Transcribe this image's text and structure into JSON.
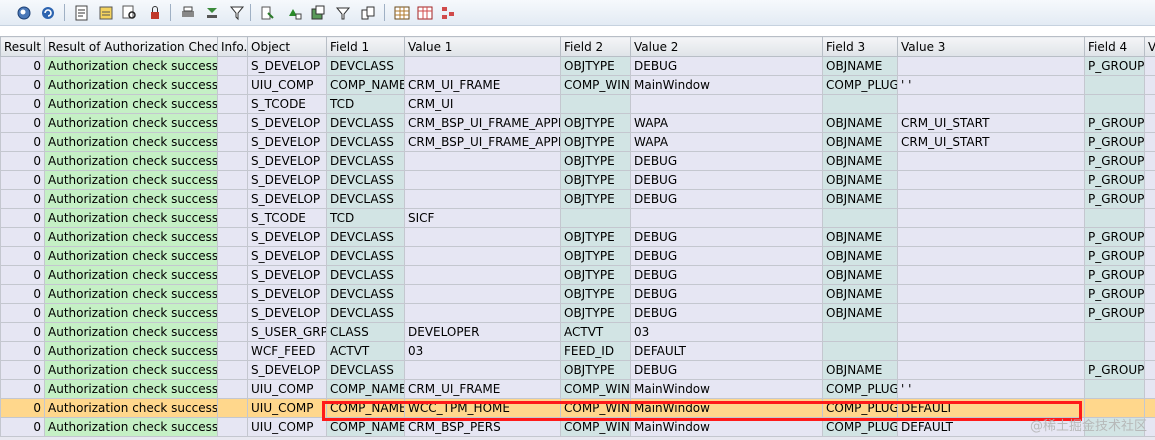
{
  "toolbar": {
    "buttons": [
      {
        "icon": "refresh-icon"
      },
      {
        "icon": "reload-icon"
      },
      {
        "icon": "details-icon"
      },
      {
        "icon": "select-all-icon"
      },
      {
        "icon": "find-icon"
      },
      {
        "icon": "lock-icon"
      },
      {
        "icon": "print-icon"
      },
      {
        "icon": "sort-icon"
      },
      {
        "icon": "filter-icon"
      },
      {
        "icon": "sum-icon"
      },
      {
        "icon": "subtotal-icon"
      },
      {
        "icon": "export-icon"
      },
      {
        "icon": "layout-icon"
      },
      {
        "icon": "view-icon"
      },
      {
        "icon": "grid-icon"
      },
      {
        "icon": "columns-icon"
      },
      {
        "icon": "tree-icon"
      }
    ]
  },
  "table": {
    "headers": [
      "Result",
      "Result of Authorization Check",
      "Info.",
      "Object",
      "Field 1",
      "Value 1",
      "Field 2",
      "Value 2",
      "Field 3",
      "Value 3",
      "Field 4",
      "V"
    ],
    "rows": [
      [
        "0",
        "Authorization check successful",
        "",
        "S_DEVELOP",
        "DEVCLASS",
        "",
        "OBJTYPE",
        "DEBUG",
        "OBJNAME",
        "",
        "P_GROUP",
        ""
      ],
      [
        "0",
        "Authorization check successful",
        "",
        "UIU_COMP",
        "COMP_NAME",
        "CRM_UI_FRAME",
        "COMP_WIN",
        "MainWindow",
        "COMP_PLUG",
        "' '",
        "",
        ""
      ],
      [
        "0",
        "Authorization check successful",
        "",
        "S_TCODE",
        "TCD",
        "CRM_UI",
        "",
        "",
        "",
        "",
        "",
        ""
      ],
      [
        "0",
        "Authorization check successful",
        "",
        "S_DEVELOP",
        "DEVCLASS",
        "CRM_BSP_UI_FRAME_APPL",
        "OBJTYPE",
        "WAPA",
        "OBJNAME",
        "CRM_UI_START",
        "P_GROUP",
        ""
      ],
      [
        "0",
        "Authorization check successful",
        "",
        "S_DEVELOP",
        "DEVCLASS",
        "CRM_BSP_UI_FRAME_APPL",
        "OBJTYPE",
        "WAPA",
        "OBJNAME",
        "CRM_UI_START",
        "P_GROUP",
        ""
      ],
      [
        "0",
        "Authorization check successful",
        "",
        "S_DEVELOP",
        "DEVCLASS",
        "",
        "OBJTYPE",
        "DEBUG",
        "OBJNAME",
        "",
        "P_GROUP",
        ""
      ],
      [
        "0",
        "Authorization check successful",
        "",
        "S_DEVELOP",
        "DEVCLASS",
        "",
        "OBJTYPE",
        "DEBUG",
        "OBJNAME",
        "",
        "P_GROUP",
        ""
      ],
      [
        "0",
        "Authorization check successful",
        "",
        "S_DEVELOP",
        "DEVCLASS",
        "",
        "OBJTYPE",
        "DEBUG",
        "OBJNAME",
        "",
        "P_GROUP",
        ""
      ],
      [
        "0",
        "Authorization check successful",
        "",
        "S_TCODE",
        "TCD",
        "SICF",
        "",
        "",
        "",
        "",
        "",
        ""
      ],
      [
        "0",
        "Authorization check successful",
        "",
        "S_DEVELOP",
        "DEVCLASS",
        "",
        "OBJTYPE",
        "DEBUG",
        "OBJNAME",
        "",
        "P_GROUP",
        ""
      ],
      [
        "0",
        "Authorization check successful",
        "",
        "S_DEVELOP",
        "DEVCLASS",
        "",
        "OBJTYPE",
        "DEBUG",
        "OBJNAME",
        "",
        "P_GROUP",
        ""
      ],
      [
        "0",
        "Authorization check successful",
        "",
        "S_DEVELOP",
        "DEVCLASS",
        "",
        "OBJTYPE",
        "DEBUG",
        "OBJNAME",
        "",
        "P_GROUP",
        ""
      ],
      [
        "0",
        "Authorization check successful",
        "",
        "S_DEVELOP",
        "DEVCLASS",
        "",
        "OBJTYPE",
        "DEBUG",
        "OBJNAME",
        "",
        "P_GROUP",
        ""
      ],
      [
        "0",
        "Authorization check successful",
        "",
        "S_DEVELOP",
        "DEVCLASS",
        "",
        "OBJTYPE",
        "DEBUG",
        "OBJNAME",
        "",
        "P_GROUP",
        ""
      ],
      [
        "0",
        "Authorization check successful",
        "",
        "S_USER_GRP",
        "CLASS",
        "DEVELOPER",
        "ACTVT",
        "03",
        "",
        "",
        "",
        ""
      ],
      [
        "0",
        "Authorization check successful",
        "",
        "WCF_FEED",
        "ACTVT",
        "03",
        "FEED_ID",
        "DEFAULT",
        "",
        "",
        "",
        ""
      ],
      [
        "0",
        "Authorization check successful",
        "",
        "S_DEVELOP",
        "DEVCLASS",
        "",
        "OBJTYPE",
        "DEBUG",
        "OBJNAME",
        "",
        "P_GROUP",
        ""
      ],
      [
        "0",
        "Authorization check successful",
        "",
        "UIU_COMP",
        "COMP_NAME",
        "CRM_UI_FRAME",
        "COMP_WIN",
        "MainWindow",
        "COMP_PLUG",
        "' '",
        "",
        ""
      ],
      [
        "0",
        "Authorization check successful",
        "",
        "UIU_COMP",
        "COMP_NAME",
        "WCC_TPM_HOME",
        "COMP_WIN",
        "MainWindow",
        "COMP_PLUG",
        "DEFAULT",
        "",
        ""
      ],
      [
        "0",
        "Authorization check successful",
        "",
        "UIU_COMP",
        "COMP_NAME",
        "CRM_BSP_PERS",
        "COMP_WIN",
        "MainWindow",
        "COMP_PLUG",
        "DEFAULT",
        "",
        ""
      ]
    ],
    "selected_row": 18
  },
  "watermark": "@稀土掘金技术社区",
  "colors": {
    "success_cell": "#c5f0c5",
    "field_cell": "#d2e4e4",
    "selected_row": "#ffd78c",
    "highlight_border": "#ff1a1a"
  }
}
